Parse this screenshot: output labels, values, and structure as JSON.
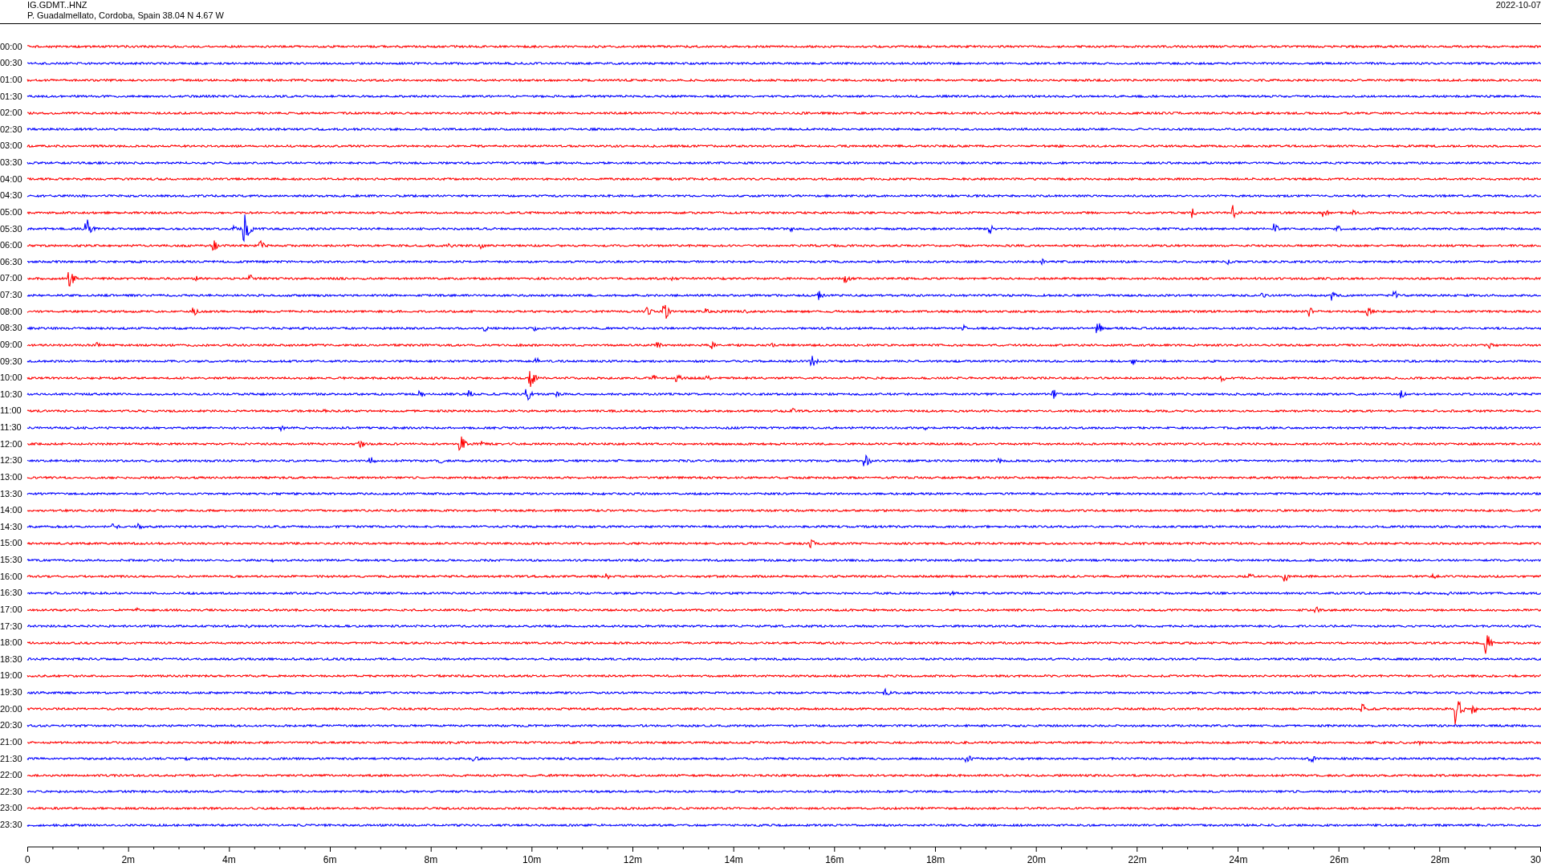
{
  "header": {
    "station": "IG.GDMT..HNZ",
    "location": "P. Guadalmellato, Cordoba, Spain  38.04 N 4.67 W",
    "date": "2022-10-07"
  },
  "traces": [
    {
      "label": "00:00",
      "color": "#ff0000"
    },
    {
      "label": "00:30",
      "color": "#0000ff"
    },
    {
      "label": "01:00",
      "color": "#ff0000"
    },
    {
      "label": "01:30",
      "color": "#0000ff"
    },
    {
      "label": "02:00",
      "color": "#ff0000"
    },
    {
      "label": "02:30",
      "color": "#0000ff"
    },
    {
      "label": "03:00",
      "color": "#ff0000"
    },
    {
      "label": "03:30",
      "color": "#0000ff"
    },
    {
      "label": "04:00",
      "color": "#ff0000"
    },
    {
      "label": "04:30",
      "color": "#0000ff"
    },
    {
      "label": "05:00",
      "color": "#ff0000"
    },
    {
      "label": "05:30",
      "color": "#0000ff"
    },
    {
      "label": "06:00",
      "color": "#ff0000"
    },
    {
      "label": "06:30",
      "color": "#0000ff"
    },
    {
      "label": "07:00",
      "color": "#ff0000"
    },
    {
      "label": "07:30",
      "color": "#0000ff"
    },
    {
      "label": "08:00",
      "color": "#ff0000"
    },
    {
      "label": "08:30",
      "color": "#0000ff"
    },
    {
      "label": "09:00",
      "color": "#ff0000"
    },
    {
      "label": "09:30",
      "color": "#0000ff"
    },
    {
      "label": "10:00",
      "color": "#ff0000"
    },
    {
      "label": "10:30",
      "color": "#0000ff"
    },
    {
      "label": "11:00",
      "color": "#ff0000"
    },
    {
      "label": "11:30",
      "color": "#0000ff"
    },
    {
      "label": "12:00",
      "color": "#ff0000"
    },
    {
      "label": "12:30",
      "color": "#0000ff"
    },
    {
      "label": "13:00",
      "color": "#ff0000"
    },
    {
      "label": "13:30",
      "color": "#0000ff"
    },
    {
      "label": "14:00",
      "color": "#ff0000"
    },
    {
      "label": "14:30",
      "color": "#0000ff"
    },
    {
      "label": "15:00",
      "color": "#ff0000"
    },
    {
      "label": "15:30",
      "color": "#0000ff"
    },
    {
      "label": "16:00",
      "color": "#ff0000"
    },
    {
      "label": "16:30",
      "color": "#0000ff"
    },
    {
      "label": "17:00",
      "color": "#ff0000"
    },
    {
      "label": "17:30",
      "color": "#0000ff"
    },
    {
      "label": "18:00",
      "color": "#ff0000"
    },
    {
      "label": "18:30",
      "color": "#0000ff"
    },
    {
      "label": "19:00",
      "color": "#ff0000"
    },
    {
      "label": "19:30",
      "color": "#0000ff"
    },
    {
      "label": "20:00",
      "color": "#ff0000"
    },
    {
      "label": "20:30",
      "color": "#0000ff"
    },
    {
      "label": "21:00",
      "color": "#ff0000"
    },
    {
      "label": "21:30",
      "color": "#0000ff"
    },
    {
      "label": "22:00",
      "color": "#ff0000"
    },
    {
      "label": "22:30",
      "color": "#0000ff"
    },
    {
      "label": "23:00",
      "color": "#ff0000"
    },
    {
      "label": "23:30",
      "color": "#0000ff"
    }
  ],
  "axis": {
    "ticks": [
      "0",
      "2m",
      "4m",
      "6m",
      "8m",
      "10m",
      "12m",
      "14m",
      "16m",
      "18m",
      "20m",
      "22m",
      "24m",
      "26m",
      "28m",
      "30"
    ]
  }
}
